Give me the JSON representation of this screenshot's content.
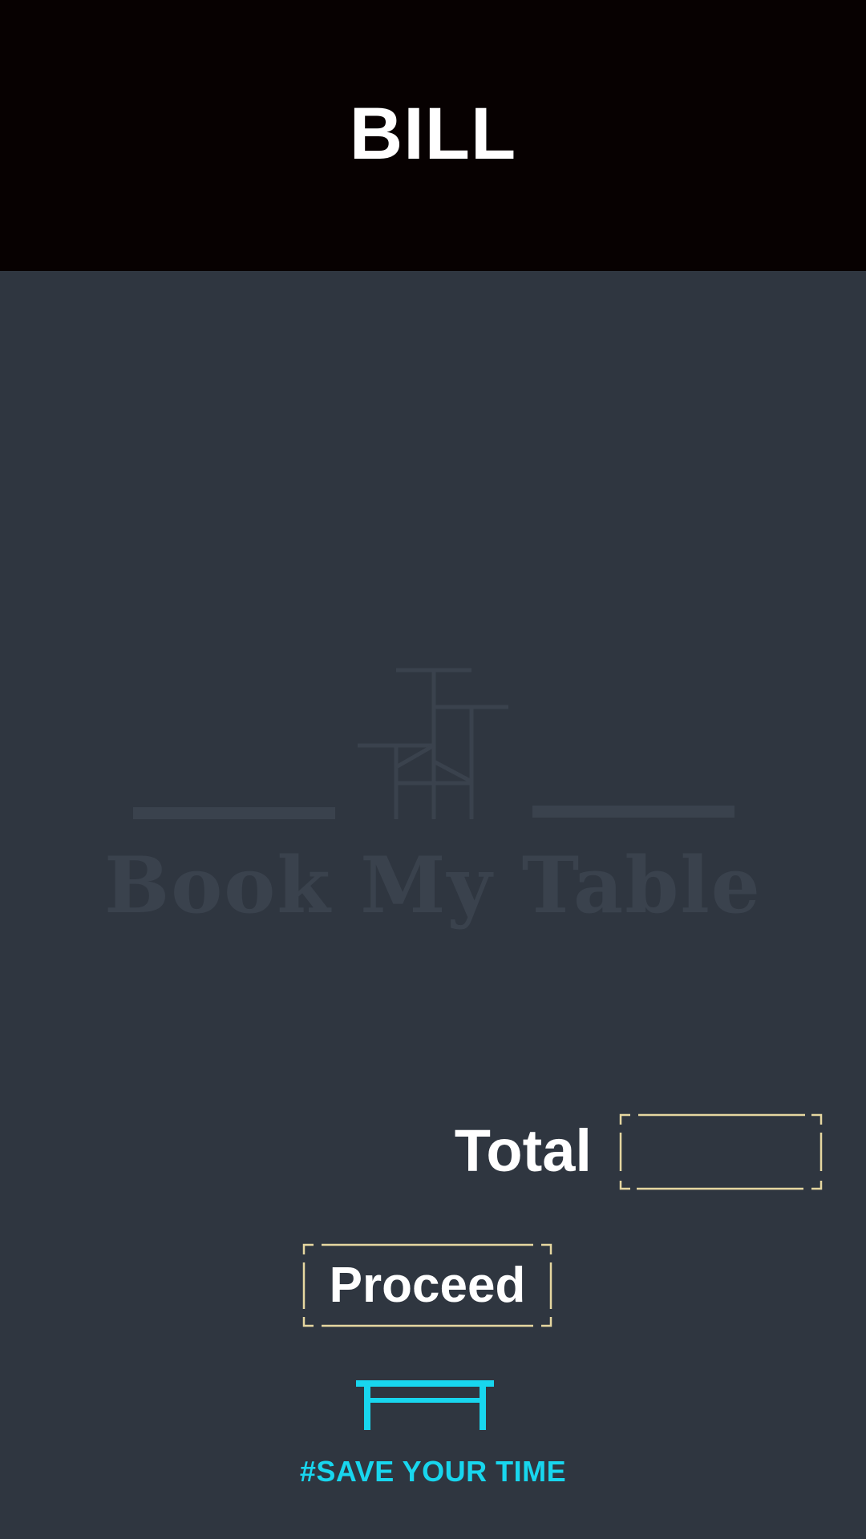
{
  "header": {
    "title": "BILL"
  },
  "watermark": {
    "brand_text": "Book My Table",
    "icon": "chair-table-logo-icon"
  },
  "total": {
    "label": "Total",
    "value": ""
  },
  "proceed": {
    "label": "Proceed"
  },
  "footer": {
    "icon": "table-icon",
    "tagline": "#SAVE YOUR TIME"
  },
  "colors": {
    "header_bg": "#070101",
    "page_bg": "#2f3640",
    "frame": "#e6d7a0",
    "accent": "#18d6ee",
    "watermark": "#3a424d"
  }
}
